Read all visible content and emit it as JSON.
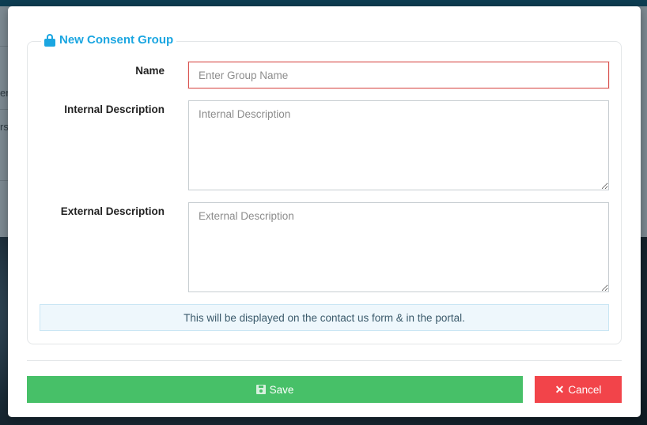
{
  "background": {
    "fragments": [
      "en",
      "rs"
    ]
  },
  "modal": {
    "legend_title": "New Consent Group",
    "icons": {
      "legend": "lock-icon",
      "save": "floppy-disk-icon",
      "cancel": "close-icon"
    },
    "fields": {
      "name": {
        "label": "Name",
        "value": "",
        "placeholder": "Enter Group Name"
      },
      "internal_description": {
        "label": "Internal Description",
        "value": "",
        "placeholder": "Internal Description"
      },
      "external_description": {
        "label": "External Description",
        "value": "",
        "placeholder": "External Description"
      }
    },
    "info_text": "This will be displayed on the contact us form & in the portal.",
    "buttons": {
      "save_label": "Save",
      "cancel_label": "Cancel",
      "cancel_glyph": "✕"
    },
    "colors": {
      "accent": "#1ba6e1",
      "save": "#47c068",
      "cancel": "#f2444a",
      "error_border": "#d9534f",
      "info_bg": "#eef7fc"
    }
  }
}
